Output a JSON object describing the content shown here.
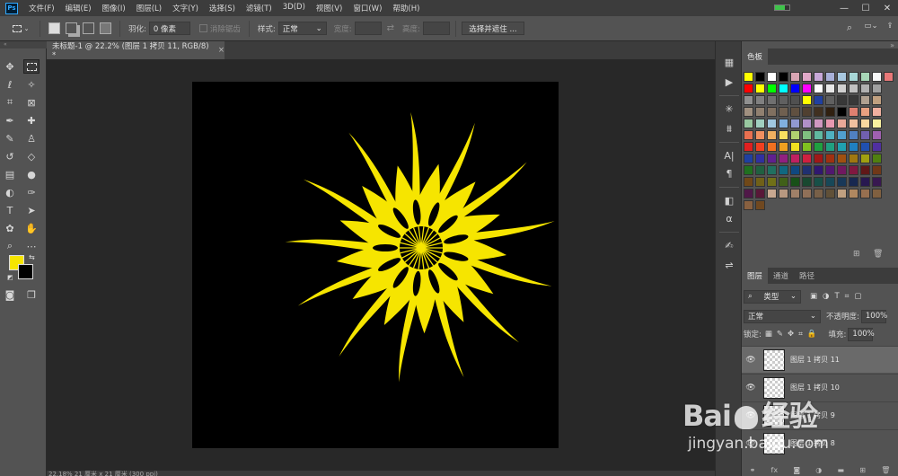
{
  "app": {
    "logo": "Ps"
  },
  "menu": [
    "文件(F)",
    "编辑(E)",
    "图像(I)",
    "图层(L)",
    "文字(Y)",
    "选择(S)",
    "滤镜(T)",
    "3D(D)",
    "视图(V)",
    "窗口(W)",
    "帮助(H)"
  ],
  "window_controls": {
    "minimize": "—",
    "maximize": "☐",
    "close": "✕"
  },
  "options": {
    "feather_label": "羽化:",
    "feather_value": "0 像素",
    "antialias_label": "消除锯齿",
    "style_label": "样式:",
    "style_value": "正常",
    "width_label": "宽度:",
    "height_label": "高度:",
    "select_mask_button": "选择并遮住 ..."
  },
  "document_tab": {
    "title": "未标题-1 @ 22.2% (图层 1 拷贝 11, RGB/8) *",
    "close": "×"
  },
  "status": {
    "text": "22.18%     21 厘米 x 21 厘米 (300 ppi)"
  },
  "colors": {
    "foreground": "#f6e500",
    "background": "#000000",
    "flower": "#f6e500"
  },
  "swatches_panel": {
    "tab": "色板"
  },
  "swatches": [
    [
      "#ffff00",
      "#000000",
      "#ffffff",
      "#000000",
      "#d8a5b3",
      "#e0a8c8",
      "#c8a8d8",
      "#a8b0d8",
      "#a8c8e0",
      "#a8d8d8",
      "#a8d8b8",
      "#f8f8f8",
      "#e87878"
    ],
    [
      "#ff0000",
      "#ffff00",
      "#00ff00",
      "#00ffff",
      "#0000ff",
      "#ff00ff",
      "#ffffff",
      "#e8e8e8",
      "#d0d0d0",
      "#c0c0c0",
      "#b0b0b0",
      "#a0a0a0"
    ],
    [
      "#909090",
      "#808080",
      "#707070",
      "#606060",
      "#505050",
      "#ffff00",
      "#2040a0",
      "#606060",
      "#383838",
      "#383838",
      "#b0a090",
      "#c0a080"
    ],
    [
      "#a09080",
      "#908070",
      "#807060",
      "#706050",
      "#605040",
      "#504030",
      "#403020",
      "#302010",
      "#000000",
      "#e08070",
      "#e8a080",
      "#f0b0a0"
    ],
    [
      "#98c8a0",
      "#a0d0c0",
      "#a0c8e0",
      "#80b0e0",
      "#9098d0",
      "#b090c8",
      "#d098c0",
      "#e898b0",
      "#e8a898",
      "#f0c0a0",
      "#f8d8a0",
      "#f8f0a0"
    ],
    [
      "#e87050",
      "#f09060",
      "#f0b060",
      "#f8e060",
      "#b0d070",
      "#80c080",
      "#60b8a0",
      "#50b0c0",
      "#50a0d0",
      "#5080c0",
      "#7060b0",
      "#a060b0"
    ],
    [
      "#e02020",
      "#f04020",
      "#f07020",
      "#f0a020",
      "#f0e020",
      "#80c020",
      "#20a040",
      "#20a080",
      "#20a0b0",
      "#2080c0",
      "#2050b0",
      "#5030a0"
    ],
    [
      "#2040a0",
      "#3030a0",
      "#602090",
      "#902080",
      "#c02060",
      "#d02040",
      "#a01818",
      "#a03010",
      "#a05010",
      "#a07810",
      "#a0a010",
      "#508010"
    ],
    [
      "#207020",
      "#206040",
      "#207060",
      "#106880",
      "#104880",
      "#203070",
      "#301870",
      "#501870",
      "#701860",
      "#801840",
      "#601818",
      "#703818"
    ],
    [
      "#704818",
      "#706018",
      "#707018",
      "#406018",
      "#185018",
      "#184830",
      "#185048",
      "#184858",
      "#183858",
      "#182850",
      "#281850",
      "#381850"
    ],
    [
      "#501848",
      "#581838",
      "#c8a890",
      "#b89880",
      "#a08068",
      "#907058",
      "#786048",
      "#605038",
      "#c0a080",
      "#b08860",
      "#987050",
      "#806040"
    ],
    [
      "#886040",
      "#704820"
    ]
  ],
  "layers_panel": {
    "tabs": [
      "图层",
      "通道",
      "路径"
    ],
    "filter_kind": "类型",
    "blend_mode": "正常",
    "opacity_label": "不透明度:",
    "opacity_value": "100%",
    "lock_label": "锁定:",
    "fill_label": "填充:",
    "fill_value": "100%",
    "layers": [
      {
        "name": "图层 1 拷贝 11",
        "active": true
      },
      {
        "name": "图层 1 拷贝 10",
        "active": false
      },
      {
        "name": "图层 1 拷贝 9",
        "active": false
      },
      {
        "name": "图层 1 拷贝 8",
        "active": false
      }
    ]
  },
  "watermark": {
    "brand": "Bai",
    "brand2": "经验",
    "url": "jingyan.baidu.com"
  }
}
